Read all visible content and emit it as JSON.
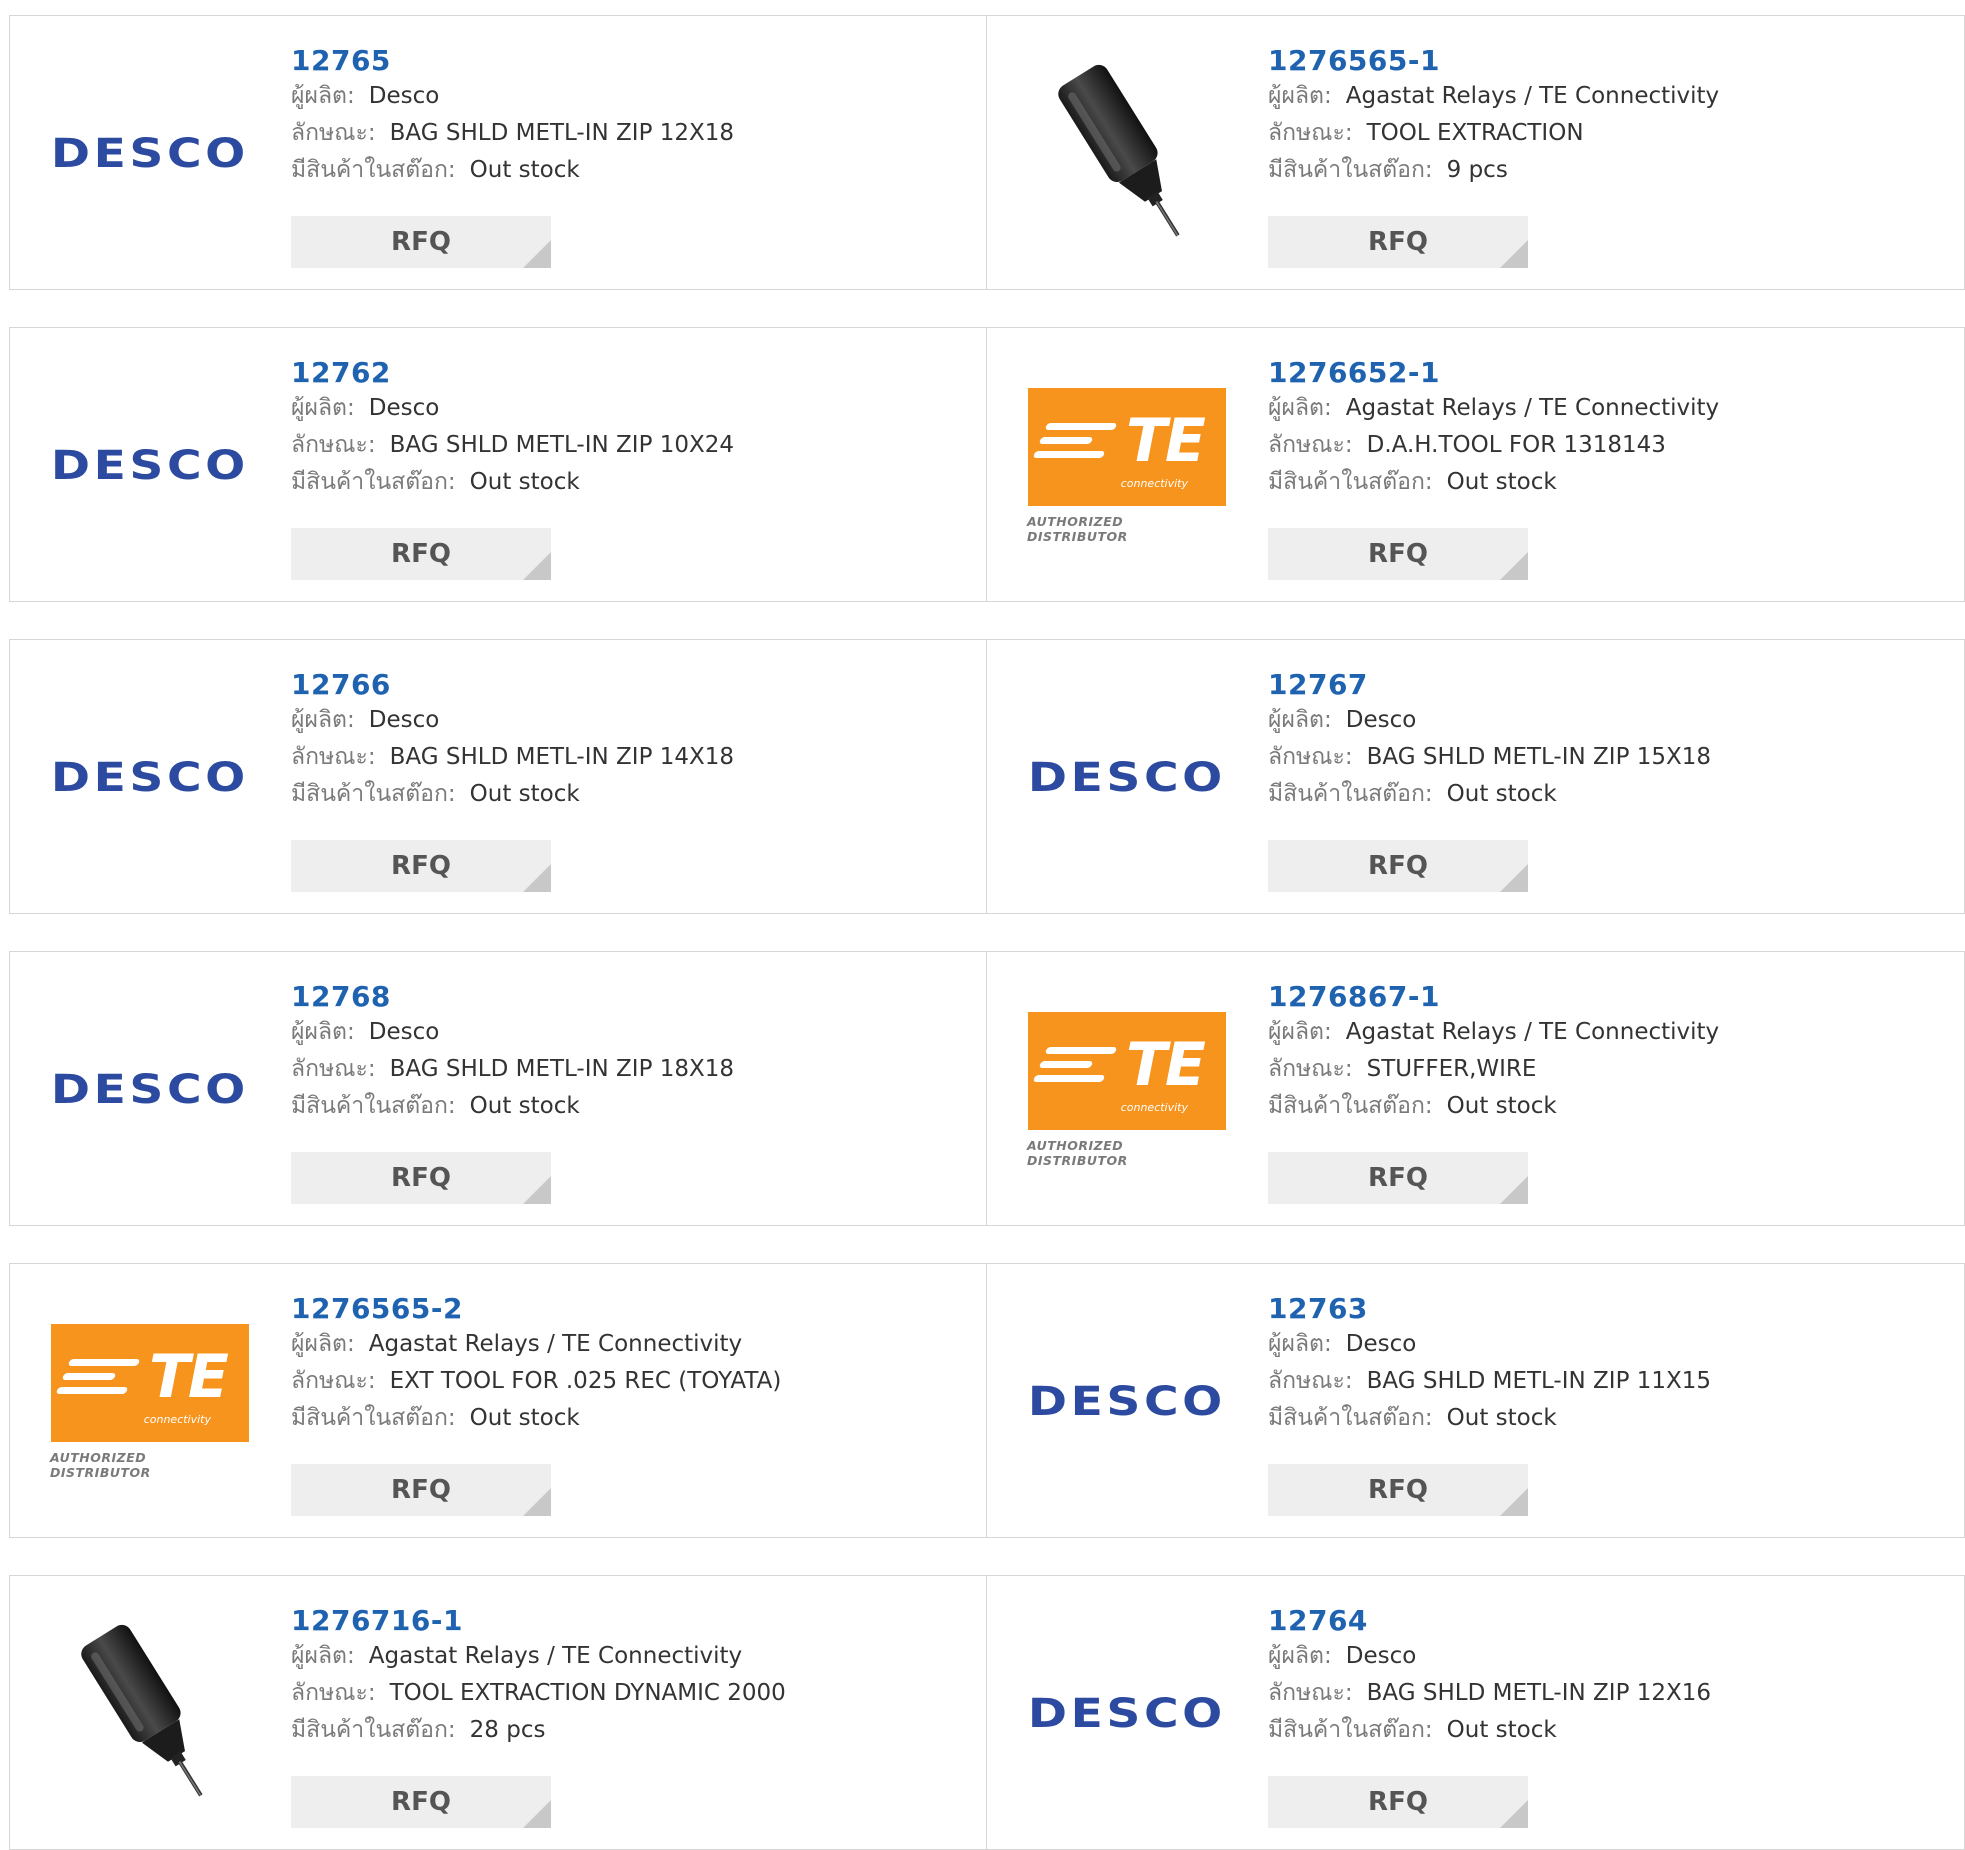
{
  "labels": {
    "manufacturer": "ผู้ผลิต:",
    "description": "ลักษณะ:",
    "stock": "มีสินค้าในสต๊อก:",
    "rfq": "RFQ"
  },
  "logo_text": {
    "desco": "DESCO",
    "te": "TE",
    "te_sub": "connectivity",
    "te_authorized": "AUTHORIZED DISTRIBUTOR"
  },
  "colors": {
    "part_link": "#1f63b0",
    "desco_blue": "#2b4aa0",
    "te_orange": "#f7941d",
    "rfq_bg": "#eeeeee"
  },
  "rows": [
    [
      {
        "part": "12765",
        "manufacturer": "Desco",
        "description": "BAG SHLD METL-IN ZIP 12X18",
        "stock": "Out stock",
        "image": "desco-logo"
      },
      {
        "part": "1276565-1",
        "manufacturer": "Agastat Relays / TE Connectivity",
        "description": "TOOL EXTRACTION",
        "stock": "9 pcs",
        "image": "extraction-tool-photo"
      }
    ],
    [
      {
        "part": "12762",
        "manufacturer": "Desco",
        "description": "BAG SHLD METL-IN ZIP 10X24",
        "stock": "Out stock",
        "image": "desco-logo"
      },
      {
        "part": "1276652-1",
        "manufacturer": "Agastat Relays / TE Connectivity",
        "description": "D.A.H.TOOL FOR 1318143",
        "stock": "Out stock",
        "image": "te-logo"
      }
    ],
    [
      {
        "part": "12766",
        "manufacturer": "Desco",
        "description": "BAG SHLD METL-IN ZIP 14X18",
        "stock": "Out stock",
        "image": "desco-logo"
      },
      {
        "part": "12767",
        "manufacturer": "Desco",
        "description": "BAG SHLD METL-IN ZIP 15X18",
        "stock": "Out stock",
        "image": "desco-logo"
      }
    ],
    [
      {
        "part": "12768",
        "manufacturer": "Desco",
        "description": "BAG SHLD METL-IN ZIP 18X18",
        "stock": "Out stock",
        "image": "desco-logo"
      },
      {
        "part": "1276867-1",
        "manufacturer": "Agastat Relays / TE Connectivity",
        "description": "STUFFER,WIRE",
        "stock": "Out stock",
        "image": "te-logo"
      }
    ],
    [
      {
        "part": "1276565-2",
        "manufacturer": "Agastat Relays / TE Connectivity",
        "description": "EXT TOOL FOR .025 REC (TOYATA)",
        "stock": "Out stock",
        "image": "te-logo"
      },
      {
        "part": "12763",
        "manufacturer": "Desco",
        "description": "BAG SHLD METL-IN ZIP 11X15",
        "stock": "Out stock",
        "image": "desco-logo"
      }
    ],
    [
      {
        "part": "1276716-1",
        "manufacturer": "Agastat Relays / TE Connectivity",
        "description": "TOOL EXTRACTION DYNAMIC 2000",
        "stock": "28 pcs",
        "image": "extraction-tool-photo"
      },
      {
        "part": "12764",
        "manufacturer": "Desco",
        "description": "BAG SHLD METL-IN ZIP 12X16",
        "stock": "Out stock",
        "image": "desco-logo"
      }
    ]
  ]
}
